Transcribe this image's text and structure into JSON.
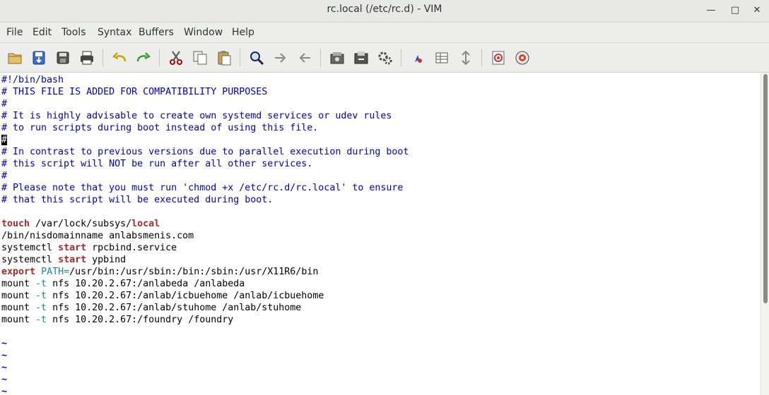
{
  "window": {
    "title": "rc.local (/etc/rc.d) - VIM",
    "minimize": "—",
    "maximize": "□",
    "close": "✕"
  },
  "menu": [
    "File",
    "Edit",
    "Tools",
    "Syntax",
    "Buffers",
    "Window",
    "Help"
  ],
  "toolbar_icons": [
    "open-icon",
    "save-icon",
    "save-all-icon",
    "print-icon",
    "undo-icon",
    "redo-icon",
    "cut-icon",
    "copy-icon",
    "paste-icon",
    "find-replace-icon",
    "find-next-icon",
    "find-previous-icon",
    "load-session-icon",
    "save-session-icon",
    "run-script-icon",
    "make-icon",
    "shell-icon",
    "run-ctags-icon",
    "help-icon",
    "find-help-icon"
  ],
  "lines": [
    [
      [
        "#!/bin/bash",
        "c"
      ]
    ],
    [
      [
        "# THIS FILE IS ADDED FOR COMPATIBILITY PURPOSES",
        "c"
      ]
    ],
    [
      [
        "#",
        "c"
      ]
    ],
    [
      [
        "# It is highly advisable to create own systemd services or udev rules",
        "c"
      ]
    ],
    [
      [
        "# to run scripts during boot instead of using this file.",
        "c"
      ]
    ],
    [
      [
        "#",
        "cursor"
      ]
    ],
    [
      [
        "# In contrast to previous versions due to parallel execution during boot",
        "c"
      ]
    ],
    [
      [
        "# this script will NOT be run after all other services.",
        "c"
      ]
    ],
    [
      [
        "#",
        "c"
      ]
    ],
    [
      [
        "# Please note that you must run 'chmod +x /etc/rc.d/rc.local' to ensure",
        "c"
      ]
    ],
    [
      [
        "# that this script will be executed during boot.",
        "c"
      ]
    ],
    [
      [
        "",
        ""
      ]
    ],
    [
      [
        "touch",
        "k"
      ],
      [
        " /var/lock/subsys/",
        ""
      ],
      [
        "local",
        "k"
      ]
    ],
    [
      [
        "/bin/nisdomainname anlabsmenis.com",
        ""
      ]
    ],
    [
      [
        "systemctl ",
        ""
      ],
      [
        "start",
        "k"
      ],
      [
        " rpcbind.service",
        ""
      ]
    ],
    [
      [
        "systemctl ",
        ""
      ],
      [
        "start",
        "k"
      ],
      [
        " ypbind",
        ""
      ]
    ],
    [
      [
        "export",
        "k"
      ],
      [
        " ",
        ""
      ],
      [
        "PATH=",
        "t"
      ],
      [
        "/usr/bin:/usr/sbin:/bin:/sbin:/usr/X11R6/bin",
        ""
      ]
    ],
    [
      [
        "mount ",
        ""
      ],
      [
        "-t",
        "t"
      ],
      [
        " nfs 10.20.2.67:/anlabeda /anlabeda",
        ""
      ]
    ],
    [
      [
        "mount ",
        ""
      ],
      [
        "-t",
        "t"
      ],
      [
        " nfs 10.20.2.67:/anlab/icbuehome /anlab/icbuehome",
        ""
      ]
    ],
    [
      [
        "mount ",
        ""
      ],
      [
        "-t",
        "t"
      ],
      [
        " nfs 10.20.2.67:/anlab/stuhome /anlab/stuhome",
        ""
      ]
    ],
    [
      [
        "mount ",
        ""
      ],
      [
        "-t",
        "t"
      ],
      [
        " nfs 10.20.2.67:/foundry /foundry",
        ""
      ]
    ],
    [
      [
        "",
        ""
      ]
    ],
    [
      [
        "~",
        "tilde"
      ]
    ],
    [
      [
        "~",
        "tilde"
      ]
    ],
    [
      [
        "~",
        "tilde"
      ]
    ],
    [
      [
        "~",
        "tilde"
      ]
    ],
    [
      [
        "~",
        "tilde"
      ]
    ]
  ]
}
